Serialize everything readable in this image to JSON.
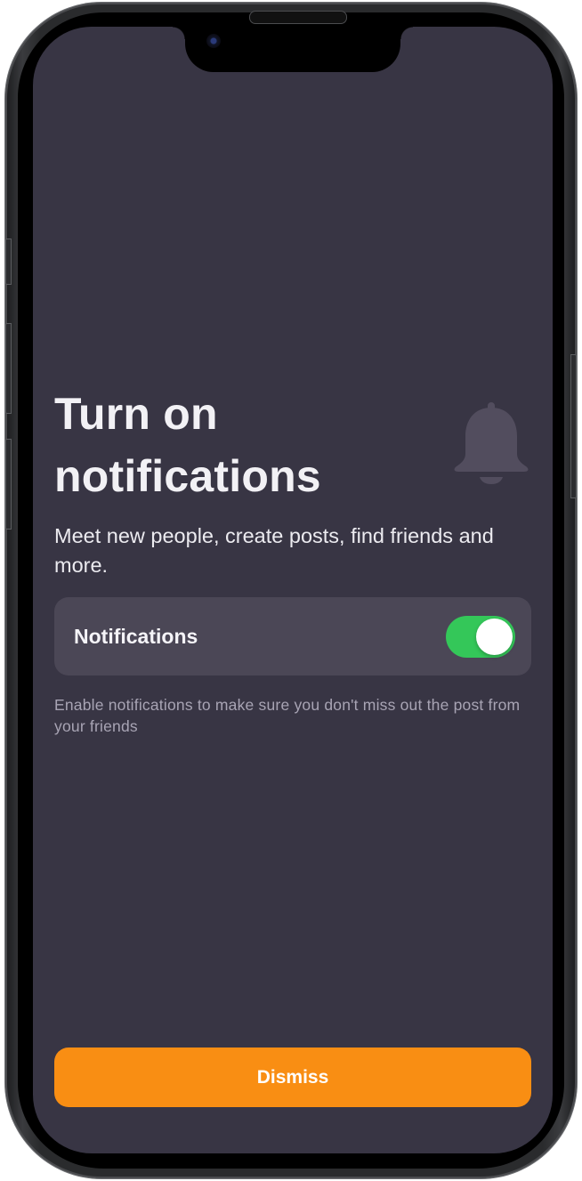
{
  "screen": {
    "title": "Turn on notifications",
    "subtitle": "Meet new people, create posts, find friends and more.",
    "bell_icon": "bell-icon"
  },
  "notifications_setting": {
    "label": "Notifications",
    "enabled": true
  },
  "helper_text": "Enable notifications to make sure you don't miss out the post from your friends",
  "actions": {
    "dismiss_label": "Dismiss"
  },
  "colors": {
    "background": "#383544",
    "card": "#4b4756",
    "toggle_on": "#34c759",
    "accent_button": "#f98e13"
  }
}
